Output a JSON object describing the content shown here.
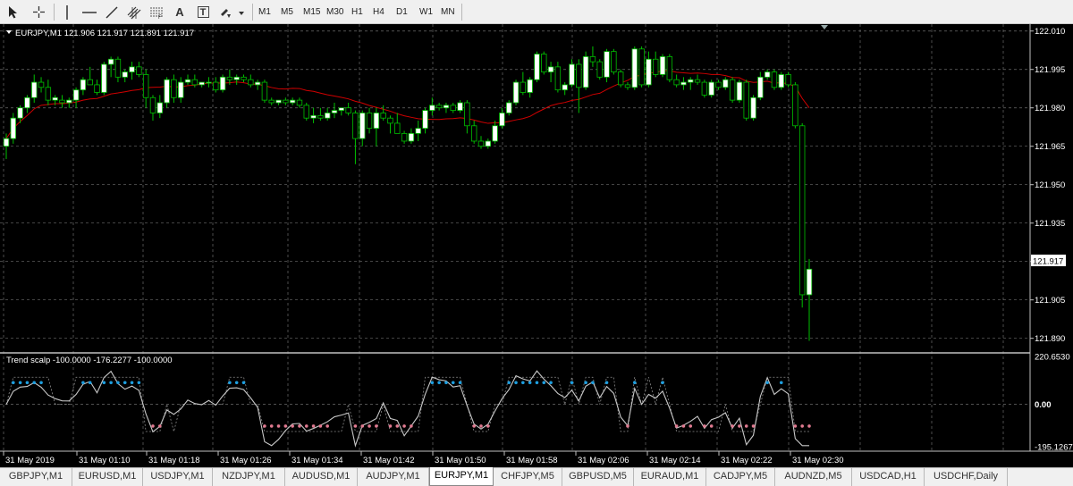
{
  "toolbar": {
    "tools": [
      {
        "icon": "cursor-arrow-icon"
      },
      {
        "icon": "crosshair-icon"
      },
      {
        "icon": "vertical-line-icon"
      },
      {
        "icon": "horizontal-line-icon"
      },
      {
        "icon": "trendline-icon"
      },
      {
        "icon": "channel-icon"
      },
      {
        "icon": "fibonacci-icon"
      },
      {
        "icon": "text-icon",
        "label": "A"
      },
      {
        "icon": "text-label-icon",
        "label": "T"
      },
      {
        "icon": "shapes-dropdown-icon"
      }
    ],
    "timeframes": [
      "M1",
      "M5",
      "M15",
      "M30",
      "H1",
      "H4",
      "D1",
      "W1",
      "MN"
    ]
  },
  "chart": {
    "header": "EURJPY,M1  121.906 121.917 121.891 121.917",
    "price_labels": [
      "122.010",
      "121.995",
      "121.980",
      "121.965",
      "121.950",
      "121.935",
      "121.920",
      "121.905",
      "121.890"
    ],
    "bid_label": "121.917",
    "time_labels": [
      "31 May 2019",
      "31 May 01:10",
      "31 May 01:18",
      "31 May 01:26",
      "31 May 01:34",
      "31 May 01:42",
      "31 May 01:50",
      "31 May 01:58",
      "31 May 02:06",
      "31 May 02:14",
      "31 May 02:22",
      "31 May 02:30"
    ],
    "indicator": {
      "header": "Trend scalp -100.0000 -176.2277 -100.0000",
      "levels": [
        "220.6530",
        "0.00",
        "-195.1267"
      ]
    },
    "colors": {
      "background": "#000000",
      "bull_candle": "#ffffff",
      "bear_candle": "#000000",
      "wick": "#00c000",
      "ma_line": "#d00000",
      "indicator_line": "#c8c8c8",
      "dot_up": "#1e9fe0",
      "dot_down": "#e07a90"
    }
  },
  "chart_data": {
    "type": "candlestick",
    "symbol": "EURJPY",
    "timeframe": "M1",
    "ylim": [
      121.885,
      122.012
    ],
    "candles_ohlc": [
      [
        121.965,
        121.97,
        121.96,
        121.968
      ],
      [
        121.968,
        121.978,
        121.966,
        121.976
      ],
      [
        121.976,
        121.981,
        121.974,
        121.98
      ],
      [
        121.98,
        121.985,
        121.978,
        121.984
      ],
      [
        121.984,
        121.993,
        121.982,
        121.99
      ],
      [
        121.99,
        121.992,
        121.986,
        121.988
      ],
      [
        121.988,
        121.991,
        121.981,
        121.983
      ],
      [
        121.983,
        121.985,
        121.981,
        121.984
      ],
      [
        121.983,
        121.985,
        121.98,
        121.982
      ],
      [
        121.982,
        121.984,
        121.98,
        121.983
      ],
      [
        121.983,
        121.988,
        121.98,
        121.987
      ],
      [
        121.987,
        121.992,
        121.985,
        121.991
      ],
      [
        121.991,
        121.996,
        121.989,
        121.989
      ],
      [
        121.989,
        121.991,
        121.985,
        121.986
      ],
      [
        121.986,
        121.998,
        121.985,
        121.997
      ],
      [
        121.997,
        122.0,
        121.992,
        121.999
      ],
      [
        121.999,
        122.0,
        121.99,
        121.992
      ],
      [
        121.992,
        121.995,
        121.99,
        121.994
      ],
      [
        121.994,
        121.998,
        121.991,
        121.996
      ],
      [
        121.996,
        121.998,
        121.992,
        121.993
      ],
      [
        121.993,
        121.995,
        121.98,
        121.984
      ],
      [
        121.984,
        121.985,
        121.975,
        121.978
      ],
      [
        121.978,
        121.985,
        121.976,
        121.982
      ],
      [
        121.982,
        121.992,
        121.98,
        121.991
      ],
      [
        121.991,
        121.993,
        121.982,
        121.984
      ],
      [
        121.984,
        121.992,
        121.982,
        121.99
      ],
      [
        121.99,
        121.993,
        121.989,
        121.991
      ],
      [
        121.991,
        121.993,
        121.988,
        121.989
      ],
      [
        121.989,
        121.99,
        121.988,
        121.99
      ],
      [
        121.99,
        121.992,
        121.988,
        121.99
      ],
      [
        121.99,
        121.992,
        121.986,
        121.987
      ],
      [
        121.987,
        121.993,
        121.986,
        121.992
      ],
      [
        121.992,
        121.995,
        121.989,
        121.991
      ],
      [
        121.991,
        121.993,
        121.989,
        121.992
      ],
      [
        121.992,
        121.993,
        121.99,
        121.991
      ],
      [
        121.991,
        121.993,
        121.988,
        121.989
      ],
      [
        121.989,
        121.991,
        121.987,
        121.99
      ],
      [
        121.99,
        121.991,
        121.982,
        121.983
      ],
      [
        121.983,
        121.984,
        121.981,
        121.982
      ],
      [
        121.982,
        121.983,
        121.981,
        121.983
      ],
      [
        121.983,
        121.984,
        121.981,
        121.982
      ],
      [
        121.982,
        121.984,
        121.981,
        121.983
      ],
      [
        121.983,
        121.984,
        121.98,
        121.981
      ],
      [
        121.981,
        121.982,
        121.975,
        121.976
      ],
      [
        121.976,
        121.98,
        121.974,
        121.977
      ],
      [
        121.977,
        121.98,
        121.975,
        121.976
      ],
      [
        121.976,
        121.98,
        121.975,
        121.978
      ],
      [
        121.978,
        121.982,
        121.976,
        121.979
      ],
      [
        121.979,
        121.98,
        121.977,
        121.98
      ],
      [
        121.98,
        121.982,
        121.977,
        121.978
      ],
      [
        121.978,
        121.979,
        121.958,
        121.968
      ],
      [
        121.968,
        121.979,
        121.965,
        121.978
      ],
      [
        121.978,
        121.98,
        121.97,
        121.972
      ],
      [
        121.972,
        121.98,
        121.965,
        121.978
      ],
      [
        121.978,
        121.981,
        121.975,
        121.976
      ],
      [
        121.976,
        121.977,
        121.97,
        121.974
      ],
      [
        121.974,
        121.978,
        121.97,
        121.97
      ],
      [
        121.97,
        121.971,
        121.966,
        121.967
      ],
      [
        121.967,
        121.972,
        121.966,
        121.97
      ],
      [
        121.97,
        121.975,
        121.967,
        121.972
      ],
      [
        121.972,
        121.98,
        121.97,
        121.979
      ],
      [
        121.979,
        121.984,
        121.977,
        121.981
      ],
      [
        121.981,
        121.982,
        121.979,
        121.98
      ],
      [
        121.98,
        121.982,
        121.978,
        121.981
      ],
      [
        121.981,
        121.982,
        121.978,
        121.979
      ],
      [
        121.979,
        121.983,
        121.978,
        121.982
      ],
      [
        121.982,
        121.983,
        121.97,
        121.973
      ],
      [
        121.973,
        121.975,
        121.966,
        121.967
      ],
      [
        121.967,
        121.969,
        121.964,
        121.965
      ],
      [
        121.965,
        121.968,
        121.964,
        121.967
      ],
      [
        121.967,
        121.975,
        121.966,
        121.973
      ],
      [
        121.973,
        121.98,
        121.972,
        121.978
      ],
      [
        121.978,
        121.983,
        121.977,
        121.982
      ],
      [
        121.982,
        121.991,
        121.981,
        121.99
      ],
      [
        121.99,
        121.994,
        121.985,
        121.986
      ],
      [
        121.986,
        121.992,
        121.984,
        121.991
      ],
      [
        121.991,
        122.002,
        121.99,
        122.001
      ],
      [
        122.001,
        122.002,
        121.993,
        121.994
      ],
      [
        121.994,
        121.998,
        121.99,
        121.996
      ],
      [
        121.996,
        121.998,
        121.986,
        121.987
      ],
      [
        121.987,
        121.99,
        121.985,
        121.989
      ],
      [
        121.989,
        121.999,
        121.988,
        121.997
      ],
      [
        121.997,
        121.999,
        121.978,
        121.988
      ],
      [
        121.988,
        122.002,
        121.987,
        122.0
      ],
      [
        122.0,
        122.004,
        121.996,
        121.998
      ],
      [
        121.998,
        121.999,
        121.991,
        121.992
      ],
      [
        121.992,
        122.003,
        121.99,
        122.002
      ],
      [
        122.002,
        122.003,
        121.993,
        121.994
      ],
      [
        121.994,
        121.995,
        121.988,
        121.989
      ],
      [
        121.989,
        121.99,
        121.987,
        121.988
      ],
      [
        121.988,
        122.004,
        121.987,
        122.003
      ],
      [
        122.003,
        122.004,
        121.988,
        121.989
      ],
      [
        121.989,
        122.002,
        121.988,
        121.999
      ],
      [
        121.999,
        122.002,
        121.992,
        121.993
      ],
      [
        121.993,
        122.001,
        121.992,
        122.0
      ],
      [
        122.0,
        122.001,
        121.99,
        121.991
      ],
      [
        121.991,
        121.993,
        121.988,
        121.989
      ],
      [
        121.989,
        121.992,
        121.987,
        121.99
      ],
      [
        121.99,
        121.992,
        121.987,
        121.991
      ],
      [
        121.991,
        121.993,
        121.989,
        121.99
      ],
      [
        121.99,
        121.991,
        121.984,
        121.985
      ],
      [
        121.985,
        121.991,
        121.984,
        121.99
      ],
      [
        121.99,
        121.991,
        121.987,
        121.988
      ],
      [
        121.988,
        121.992,
        121.987,
        121.991
      ],
      [
        121.991,
        121.992,
        121.982,
        121.983
      ],
      [
        121.983,
        121.991,
        121.982,
        121.99
      ],
      [
        121.99,
        121.991,
        121.975,
        121.976
      ],
      [
        121.976,
        121.985,
        121.975,
        121.984
      ],
      [
        121.984,
        121.994,
        121.983,
        121.992
      ],
      [
        121.992,
        121.995,
        121.991,
        121.994
      ],
      [
        121.994,
        121.995,
        121.987,
        121.988
      ],
      [
        121.988,
        121.994,
        121.987,
        121.993
      ],
      [
        121.993,
        121.994,
        121.988,
        121.989
      ],
      [
        121.989,
        121.99,
        121.972,
        121.973
      ],
      [
        121.973,
        121.974,
        121.902,
        121.907
      ],
      [
        121.907,
        121.921,
        121.889,
        121.917
      ]
    ],
    "ma_period": 20
  }
}
